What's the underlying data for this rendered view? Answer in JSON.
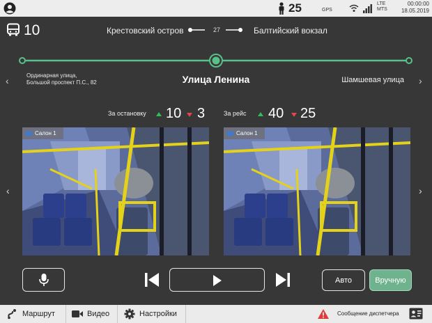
{
  "status_bar": {
    "passenger_count": "25",
    "gps_label": "GPS",
    "network_type": "LTE",
    "carrier": "MTS",
    "time": "00:00:00",
    "date": "18.05.2019"
  },
  "route": {
    "number": "10",
    "from": "Крестовский остров",
    "to": "Балтийский вокзал",
    "stops_count": "27"
  },
  "stops": {
    "previous_line1": "Ординарная улица,",
    "previous_line2": "Большой проспект П.С., 82",
    "current": "Улица Ленина",
    "next": "Шамшевая улица"
  },
  "counters": {
    "stop_label": "За остановку",
    "stop_in": "10",
    "stop_out": "3",
    "trip_label": "За рейс",
    "trip_in": "40",
    "trip_out": "25"
  },
  "cameras": [
    {
      "label": "Салон 1"
    },
    {
      "label": "Салон 1"
    }
  ],
  "controls": {
    "auto_label": "Авто",
    "manual_label": "Вручную"
  },
  "bottom_bar": {
    "route_tab": "Маршрут",
    "video_tab": "Видео",
    "settings_tab": "Настройки",
    "dispatcher_message": "Сообщение диспетчера"
  },
  "colors": {
    "accent_green": "#6fb38e",
    "track_green": "#59c08a",
    "up_arrow": "#2fbf5a",
    "down_arrow": "#e04848",
    "warning": "#e03a3a"
  },
  "icons": [
    "user-icon",
    "person-icon",
    "wifi-icon",
    "signal-icon",
    "bus-icon",
    "microphone-icon",
    "skip-previous-icon",
    "play-icon",
    "skip-next-icon",
    "route-icon",
    "video-camera-icon",
    "gear-icon",
    "warning-icon",
    "message-icon"
  ]
}
